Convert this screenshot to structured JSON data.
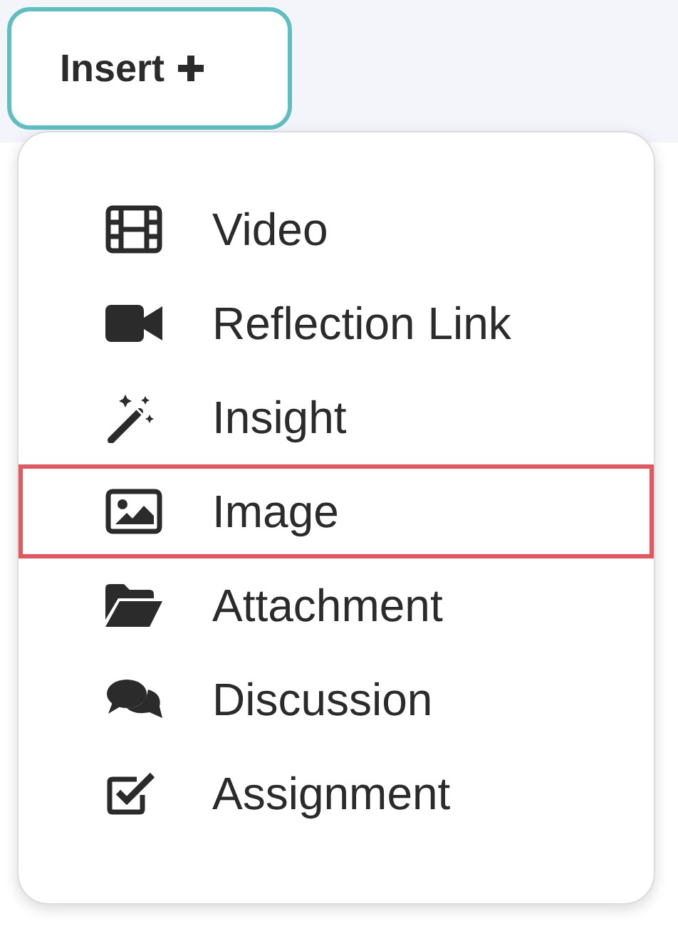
{
  "insert_button": {
    "label": "Insert",
    "expanded": true
  },
  "menu": {
    "items": [
      {
        "kind": "film",
        "label": "Video",
        "selected": false
      },
      {
        "kind": "camera",
        "label": "Reflection Link",
        "selected": false
      },
      {
        "kind": "wand",
        "label": "Insight",
        "selected": false
      },
      {
        "kind": "image",
        "label": "Image",
        "selected": true
      },
      {
        "kind": "folder",
        "label": "Attachment",
        "selected": false
      },
      {
        "kind": "comments",
        "label": "Discussion",
        "selected": false
      },
      {
        "kind": "checkbox",
        "label": "Assignment",
        "selected": false
      }
    ]
  }
}
